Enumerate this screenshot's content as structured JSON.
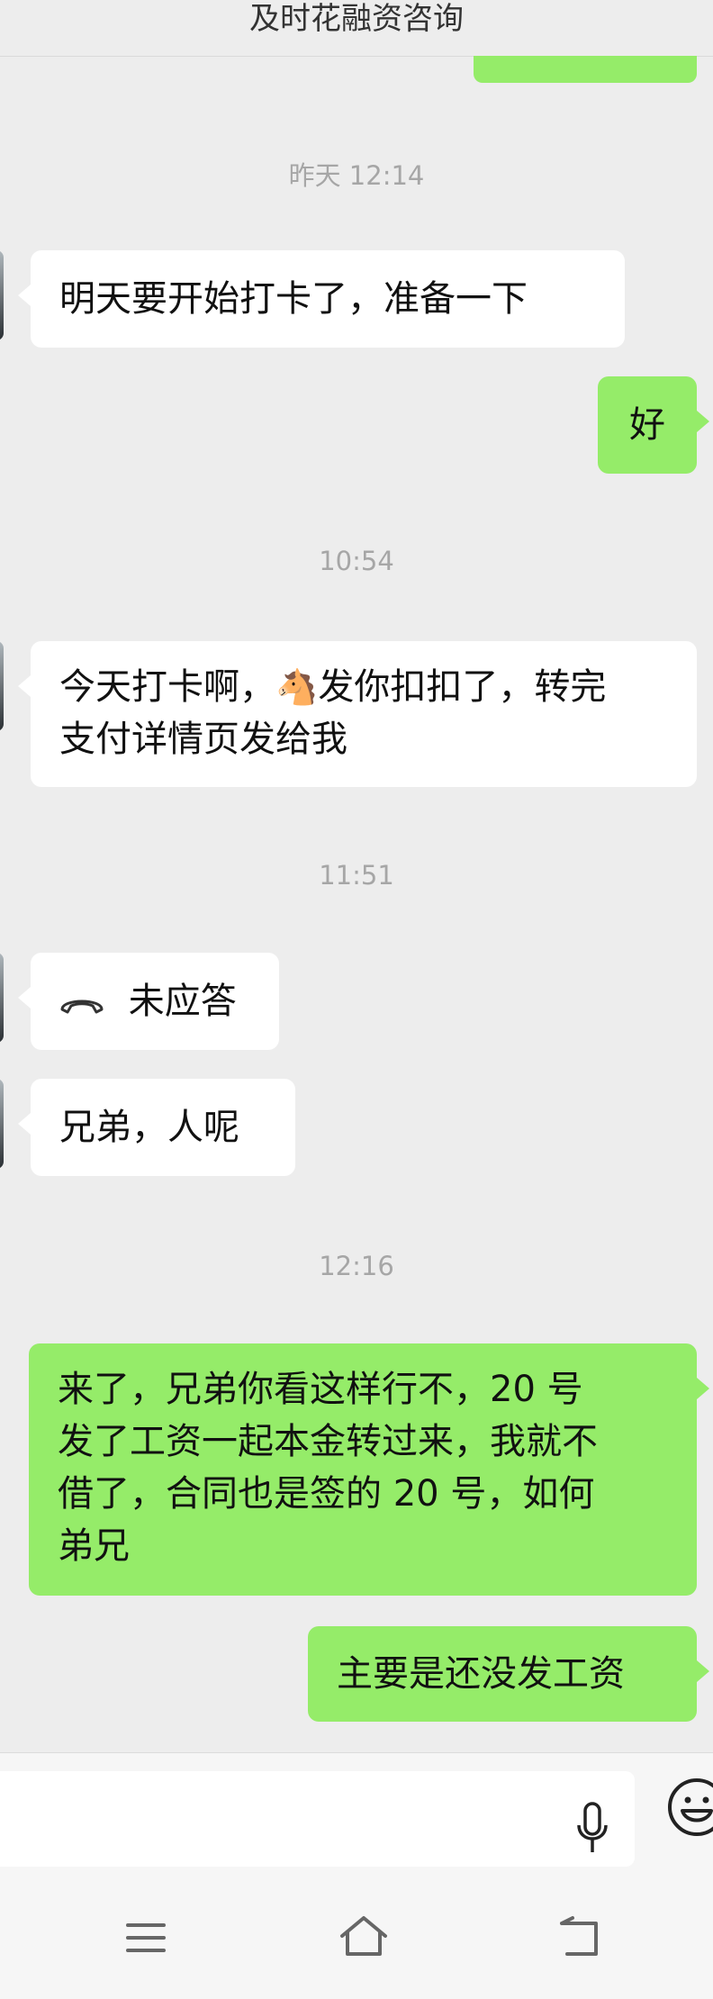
{
  "header": {
    "title": "及时花融资咨询"
  },
  "messages": [
    {
      "type": "time",
      "text": "昨天 12:14"
    },
    {
      "type": "in",
      "text": "明天要开始打卡了，准备一下"
    },
    {
      "type": "out",
      "text": "好"
    },
    {
      "type": "time",
      "text": "10:54"
    },
    {
      "type": "in",
      "line1": "今天打卡啊，",
      "emoji": "🐴",
      "line1b": "发你扣扣了，转完",
      "line2": "支付详情页发给我"
    },
    {
      "type": "time",
      "text": "11:51"
    },
    {
      "type": "in_call",
      "text": "未应答",
      "icon": "phone-hangup-icon"
    },
    {
      "type": "in",
      "text": "兄弟，人呢"
    },
    {
      "type": "time",
      "text": "12:16"
    },
    {
      "type": "out",
      "lines": [
        "来了，兄弟你看这样行不，20 号",
        "发了工资一起本金转过来，我就不",
        "借了，合同也是签的 20 号，如何",
        "弟兄"
      ]
    },
    {
      "type": "out",
      "text": "主要是还没发工资"
    }
  ],
  "input": {
    "value": ""
  },
  "icons": {
    "mic": "microphone-icon",
    "emoji": "emoji-icon",
    "menu": "menu-icon",
    "home": "home-icon",
    "back": "back-icon"
  },
  "colors": {
    "out_bubble": "#95ec69",
    "in_bubble": "#ffffff",
    "background": "#ededed"
  }
}
